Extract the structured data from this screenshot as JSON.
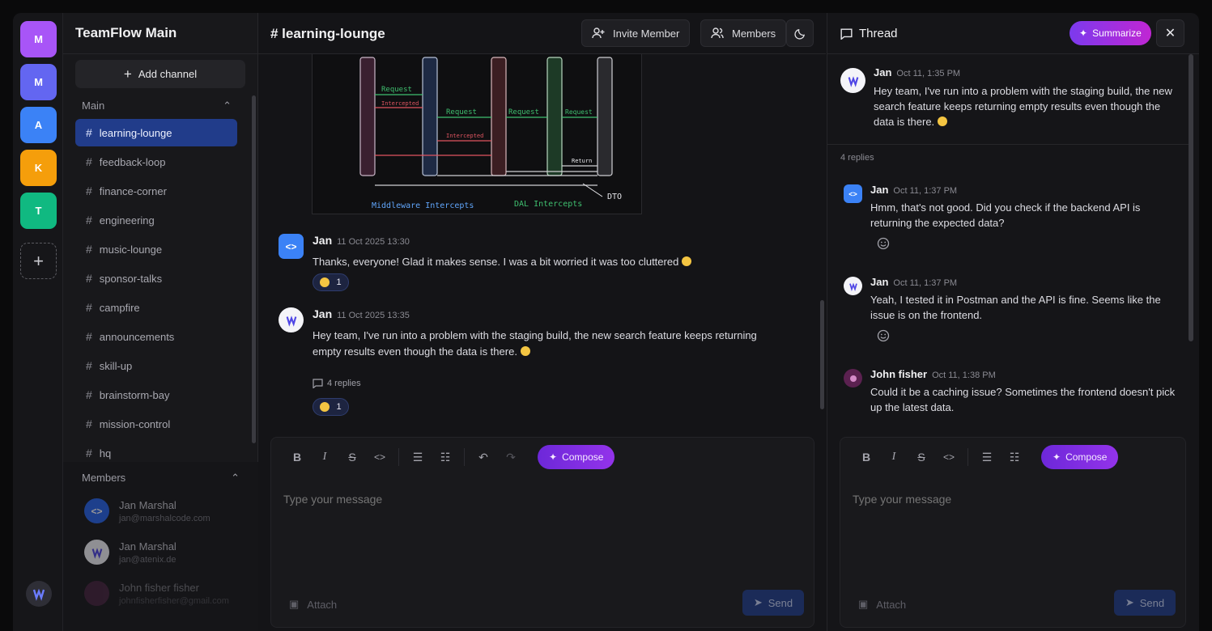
{
  "servers": [
    {
      "letter": "M",
      "color": "#a855f7"
    },
    {
      "letter": "M",
      "color": "#6366f1"
    },
    {
      "letter": "A",
      "color": "#3b82f6"
    },
    {
      "letter": "K",
      "color": "#f59e0b"
    },
    {
      "letter": "T",
      "color": "#10b981"
    }
  ],
  "sidebar": {
    "workspace_title": "TeamFlow Main",
    "add_channel_label": "Add channel",
    "section_main": "Main",
    "channels": [
      {
        "name": "learning-lounge",
        "active": true
      },
      {
        "name": "feedback-loop"
      },
      {
        "name": "finance-corner"
      },
      {
        "name": "engineering"
      },
      {
        "name": "music-lounge"
      },
      {
        "name": "sponsor-talks"
      },
      {
        "name": "campfire"
      },
      {
        "name": "announcements"
      },
      {
        "name": "skill-up"
      },
      {
        "name": "brainstorm-bay"
      },
      {
        "name": "mission-control"
      },
      {
        "name": "hq"
      }
    ],
    "section_members": "Members",
    "members": [
      {
        "name": "Jan Marshal",
        "email": "jan@marshalcode.com"
      },
      {
        "name": "Jan Marshal",
        "email": "jan@atenix.de"
      },
      {
        "name": "John fisher fisher",
        "email": "johnfisherfisher@gmail.com"
      }
    ]
  },
  "header": {
    "channel_title": "# learning-lounge",
    "invite_label": "Invite Member",
    "members_label": "Members"
  },
  "image": {
    "labels": [
      "Request",
      "Intercepted",
      "Request",
      "Intercepted",
      "Request",
      "Request",
      "Return",
      "DTO"
    ],
    "caption_left": "Middleware Intercepts",
    "caption_right": "DAL Intercepts"
  },
  "messages": [
    {
      "author": "Jan",
      "time": "11 Oct 2025 13:30",
      "text": "Thanks, everyone! Glad it makes sense. I was a bit worried it was too cluttered",
      "reaction_count": "1"
    },
    {
      "author": "Jan",
      "time": "11 Oct 2025 13:35",
      "text": "Hey team, I've run into a problem with the staging build, the new search feature keeps returning empty results even though the data is there.",
      "replies": "4 replies",
      "reaction_count": "1"
    }
  ],
  "composer": {
    "compose_label": "Compose",
    "placeholder": "Type your message",
    "attach_label": "Attach",
    "send_label": "Send"
  },
  "thread": {
    "title": "Thread",
    "summarize_label": "Summarize",
    "root": {
      "author": "Jan",
      "time": "Oct 11, 1:35 PM",
      "text": "Hey team, I've run into a problem with the staging build, the new search feature keeps returning empty results even though the data is there."
    },
    "reply_count": "4 replies",
    "replies": [
      {
        "author": "Jan",
        "time": "Oct 11, 1:37 PM",
        "text": "Hmm, that's not good. Did you check if the backend API is returning the expected data?"
      },
      {
        "author": "Jan",
        "time": "Oct 11, 1:37 PM",
        "text": "Yeah, I tested it in Postman and the API is fine. Seems like the issue is on the frontend."
      },
      {
        "author": "John fisher",
        "time": "Oct 11, 1:38 PM",
        "text": "Could it be a caching issue? Sometimes the frontend doesn't pick up the latest data."
      }
    ]
  },
  "colors": {
    "accent": "#213c8a",
    "compose": "#9333ea",
    "summarize": "#c026d3"
  }
}
